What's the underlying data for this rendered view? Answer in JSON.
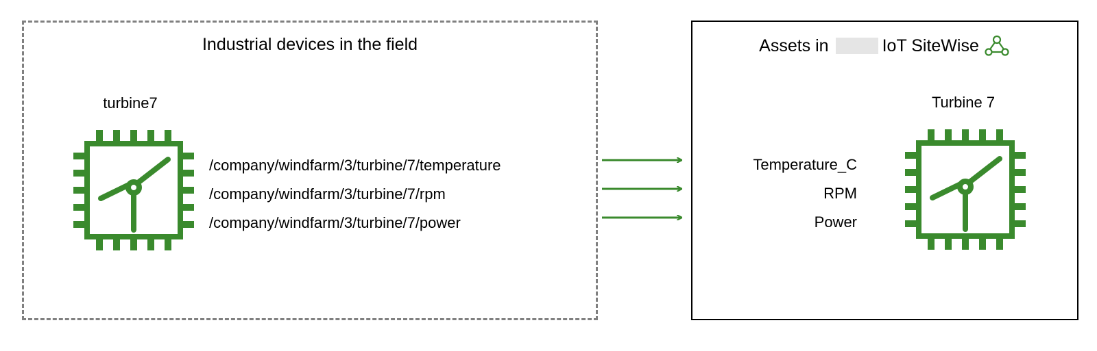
{
  "colors": {
    "green": "#3a8a2d",
    "gray": "#808080"
  },
  "left_panel": {
    "title": "Industrial devices in the field",
    "device_label": "turbine7",
    "streams": [
      "/company/windfarm/3/turbine/7/temperature",
      "/company/windfarm/3/turbine/7/rpm",
      "/company/windfarm/3/turbine/7/power"
    ]
  },
  "right_panel": {
    "title_prefix": "Assets in",
    "title_suffix": "IoT SiteWise",
    "asset_label": "Turbine 7",
    "properties": [
      "Temperature_C",
      "RPM",
      "Power"
    ]
  },
  "arrow_count": 3
}
